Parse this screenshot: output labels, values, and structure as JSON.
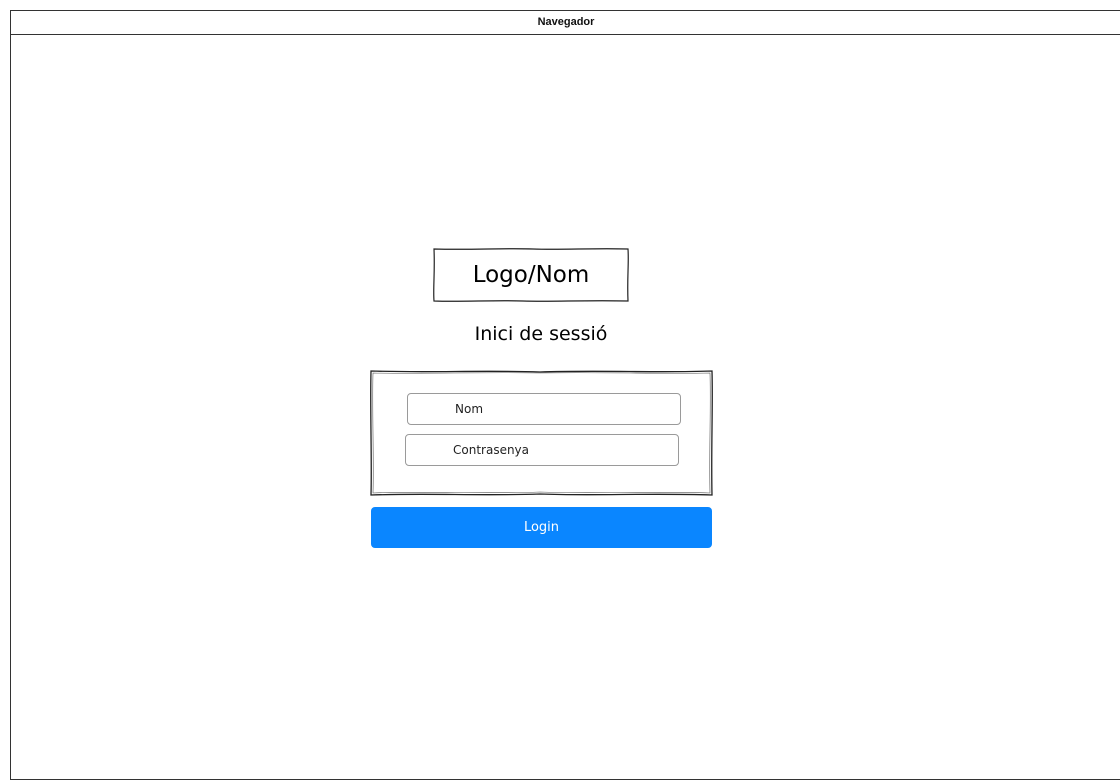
{
  "window": {
    "title": "Navegador"
  },
  "header": {
    "logo_text": "Logo/Nom",
    "heading": "Inici de sessió"
  },
  "form": {
    "username_placeholder": "Nom",
    "username_value": "",
    "password_placeholder": "Contrasenya",
    "password_value": "",
    "login_label": "Login"
  },
  "colors": {
    "accent": "#0a86ff",
    "border": "#333333",
    "field_border": "#9a9a9a",
    "background": "#ffffff"
  }
}
